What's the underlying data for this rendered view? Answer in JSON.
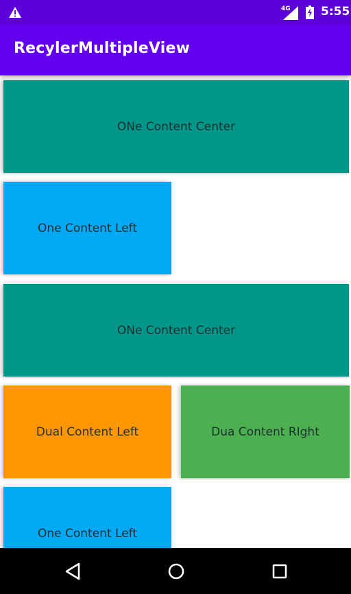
{
  "status_bar": {
    "network": "4G",
    "time": "5:55",
    "icons": [
      "warning-icon",
      "signal-icon",
      "battery-charging-icon"
    ]
  },
  "app_bar": {
    "title": "RecylerMultipleView"
  },
  "list": {
    "items": [
      {
        "layout": "one-center",
        "label": "ONe Content Center",
        "color": "#009688"
      },
      {
        "layout": "one-left",
        "label": "One Content Left",
        "color": "#03a9f4"
      },
      {
        "layout": "one-center",
        "label": "ONe Content Center",
        "color": "#009688"
      },
      {
        "layout": "dual",
        "left_label": "Dual Content Left",
        "left_color": "#ff9800",
        "right_label": "Dua Content RIght",
        "right_color": "#4caf50"
      },
      {
        "layout": "one-left",
        "label": "One Content Left",
        "color": "#03a9f4"
      }
    ]
  },
  "nav_bar": {
    "icons": [
      "back-icon",
      "home-icon",
      "recents-icon"
    ]
  },
  "colors": {
    "status_bar": "#5c02d8",
    "app_bar": "#6200ee",
    "nav_bar": "#000000",
    "card_text": "#1f2f33"
  }
}
